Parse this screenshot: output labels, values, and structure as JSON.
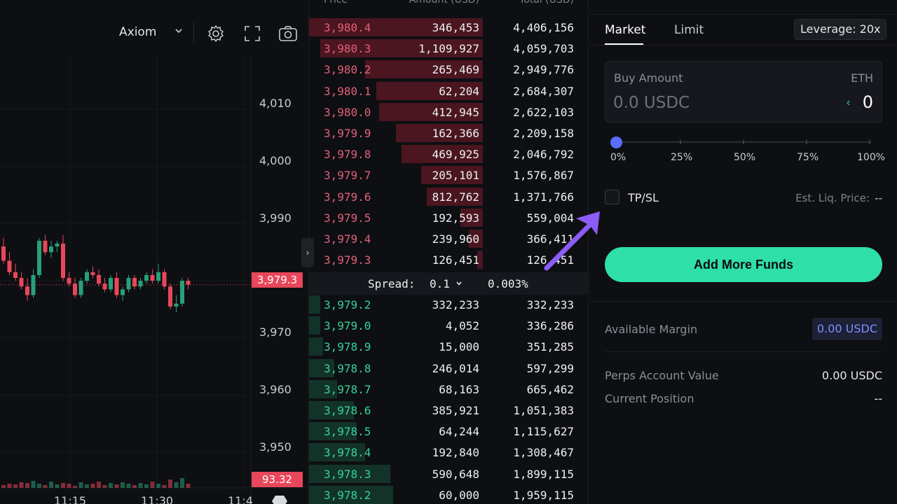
{
  "chart": {
    "provider": "Axiom",
    "price_axis": [
      "4,010",
      "4,000",
      "3,990",
      "3,970",
      "3,960",
      "3,950"
    ],
    "last_price_tag": "3,979.3",
    "volume_tag": "93.32",
    "time_labels": [
      "11:15",
      "11:30",
      "11:4"
    ],
    "up_color": "#26a17a",
    "down_color": "#e8475b",
    "candles": [
      {
        "o": 3986.0,
        "h": 3987.5,
        "l": 3983.0,
        "c": 3983.5
      },
      {
        "o": 3983.5,
        "h": 3985.0,
        "l": 3981.0,
        "c": 3981.5
      },
      {
        "o": 3981.5,
        "h": 3983.0,
        "l": 3980.0,
        "c": 3980.5
      },
      {
        "o": 3980.5,
        "h": 3981.5,
        "l": 3978.5,
        "c": 3979.0
      },
      {
        "o": 3979.0,
        "h": 3980.5,
        "l": 3976.5,
        "c": 3977.5
      },
      {
        "o": 3977.5,
        "h": 3982.0,
        "l": 3977.0,
        "c": 3981.0
      },
      {
        "o": 3981.0,
        "h": 3987.5,
        "l": 3980.5,
        "c": 3987.0
      },
      {
        "o": 3987.0,
        "h": 3988.0,
        "l": 3984.5,
        "c": 3985.0
      },
      {
        "o": 3985.0,
        "h": 3987.0,
        "l": 3984.0,
        "c": 3986.0
      },
      {
        "o": 3986.0,
        "h": 3987.0,
        "l": 3985.0,
        "c": 3986.5
      },
      {
        "o": 3986.5,
        "h": 3988.0,
        "l": 3980.0,
        "c": 3980.5
      },
      {
        "o": 3980.5,
        "h": 3981.5,
        "l": 3979.0,
        "c": 3979.5
      },
      {
        "o": 3979.5,
        "h": 3980.5,
        "l": 3977.0,
        "c": 3977.5
      },
      {
        "o": 3977.5,
        "h": 3980.5,
        "l": 3977.0,
        "c": 3980.0
      },
      {
        "o": 3980.0,
        "h": 3982.0,
        "l": 3979.5,
        "c": 3981.5
      },
      {
        "o": 3981.5,
        "h": 3982.5,
        "l": 3980.5,
        "c": 3981.0
      },
      {
        "o": 3981.0,
        "h": 3982.0,
        "l": 3979.0,
        "c": 3979.5
      },
      {
        "o": 3979.5,
        "h": 3980.5,
        "l": 3978.0,
        "c": 3978.5
      },
      {
        "o": 3978.5,
        "h": 3981.0,
        "l": 3978.0,
        "c": 3980.5
      },
      {
        "o": 3980.5,
        "h": 3981.5,
        "l": 3977.0,
        "c": 3977.5
      },
      {
        "o": 3977.5,
        "h": 3979.0,
        "l": 3976.5,
        "c": 3978.5
      },
      {
        "o": 3978.5,
        "h": 3981.0,
        "l": 3978.0,
        "c": 3980.5
      },
      {
        "o": 3980.5,
        "h": 3981.0,
        "l": 3978.5,
        "c": 3979.0
      },
      {
        "o": 3979.0,
        "h": 3980.5,
        "l": 3978.5,
        "c": 3980.0
      },
      {
        "o": 3980.0,
        "h": 3981.5,
        "l": 3979.5,
        "c": 3981.0
      },
      {
        "o": 3981.0,
        "h": 3982.0,
        "l": 3979.5,
        "c": 3980.0
      },
      {
        "o": 3980.0,
        "h": 3983.0,
        "l": 3979.5,
        "c": 3981.5
      },
      {
        "o": 3981.5,
        "h": 3982.0,
        "l": 3978.5,
        "c": 3979.0
      },
      {
        "o": 3979.0,
        "h": 3979.5,
        "l": 3975.0,
        "c": 3975.5
      },
      {
        "o": 3975.5,
        "h": 3977.5,
        "l": 3974.5,
        "c": 3976.0
      },
      {
        "o": 3976.0,
        "h": 3980.5,
        "l": 3975.5,
        "c": 3980.0
      },
      {
        "o": 3980.0,
        "h": 3980.5,
        "l": 3978.5,
        "c": 3979.3
      }
    ],
    "volumes": [
      4,
      6,
      5,
      8,
      7,
      10,
      6,
      4,
      9,
      5,
      7,
      6,
      3,
      8,
      5,
      6,
      9,
      4,
      7,
      5,
      8,
      6,
      4,
      7,
      5,
      9,
      6,
      4,
      12,
      8,
      14,
      6
    ]
  },
  "orderbook": {
    "headers": {
      "price": "Price",
      "amount": "Amount (USD)",
      "total": "Total (USD)"
    },
    "asks": [
      {
        "price": "3,980.4",
        "amount": "346,453",
        "total": "4,406,156",
        "depth": 0.62
      },
      {
        "price": "3,980.3",
        "amount": "1,109,927",
        "total": "4,059,703",
        "depth": 0.58
      },
      {
        "price": "3,980.2",
        "amount": "265,469",
        "total": "2,949,776",
        "depth": 0.42
      },
      {
        "price": "3,980.1",
        "amount": "62,204",
        "total": "2,684,307",
        "depth": 0.38
      },
      {
        "price": "3,980.0",
        "amount": "412,945",
        "total": "2,622,103",
        "depth": 0.37
      },
      {
        "price": "3,979.9",
        "amount": "162,366",
        "total": "2,209,158",
        "depth": 0.31
      },
      {
        "price": "3,979.8",
        "amount": "469,925",
        "total": "2,046,792",
        "depth": 0.29
      },
      {
        "price": "3,979.7",
        "amount": "205,101",
        "total": "1,576,867",
        "depth": 0.22
      },
      {
        "price": "3,979.6",
        "amount": "812,762",
        "total": "1,371,766",
        "depth": 0.2
      },
      {
        "price": "3,979.5",
        "amount": "192,593",
        "total": "559,004",
        "depth": 0.08
      },
      {
        "price": "3,979.4",
        "amount": "239,960",
        "total": "366,411",
        "depth": 0.05
      },
      {
        "price": "3,979.3",
        "amount": "126,451",
        "total": "126,451",
        "depth": 0.02
      }
    ],
    "spread": {
      "label": "Spread:",
      "step": "0.1",
      "percent": "0.003%"
    },
    "bids": [
      {
        "price": "3,979.2",
        "amount": "332,233",
        "total": "332,233",
        "depth": 0.04
      },
      {
        "price": "3,979.0",
        "amount": "4,052",
        "total": "336,286",
        "depth": 0.04
      },
      {
        "price": "3,978.9",
        "amount": "15,000",
        "total": "351,285",
        "depth": 0.05
      },
      {
        "price": "3,978.8",
        "amount": "246,014",
        "total": "597,299",
        "depth": 0.09
      },
      {
        "price": "3,978.7",
        "amount": "68,163",
        "total": "665,462",
        "depth": 0.1
      },
      {
        "price": "3,978.6",
        "amount": "385,921",
        "total": "1,051,383",
        "depth": 0.16
      },
      {
        "price": "3,978.5",
        "amount": "64,244",
        "total": "1,115,627",
        "depth": 0.17
      },
      {
        "price": "3,978.4",
        "amount": "192,840",
        "total": "1,308,467",
        "depth": 0.2
      },
      {
        "price": "3,978.3",
        "amount": "590,648",
        "total": "1,899,115",
        "depth": 0.29
      },
      {
        "price": "3,978.2",
        "amount": "60,000",
        "total": "1,959,115",
        "depth": 0.3
      }
    ]
  },
  "trade": {
    "tabs": {
      "market": "Market",
      "limit": "Limit"
    },
    "leverage": "Leverage: 20x",
    "buy_amount_label": "Buy Amount",
    "asset": "ETH",
    "amount_placeholder": "0.0 USDC",
    "amount_value": "0",
    "slider": {
      "value": 0,
      "labels": [
        "0%",
        "25%",
        "50%",
        "75%",
        "100%"
      ]
    },
    "tpsl_label": "TP/SL",
    "liq_label": "Est. Liq. Price:",
    "liq_value": "--",
    "cta": "Add More Funds",
    "available_margin_label": "Available Margin",
    "available_margin_value": "0.00 USDC",
    "account_value_label": "Perps Account Value",
    "account_value": "0.00 USDC",
    "position_label": "Current Position",
    "position_value": "--",
    "accent_color": "#2ee0a6",
    "arrow_color": "#8b5cf6"
  }
}
